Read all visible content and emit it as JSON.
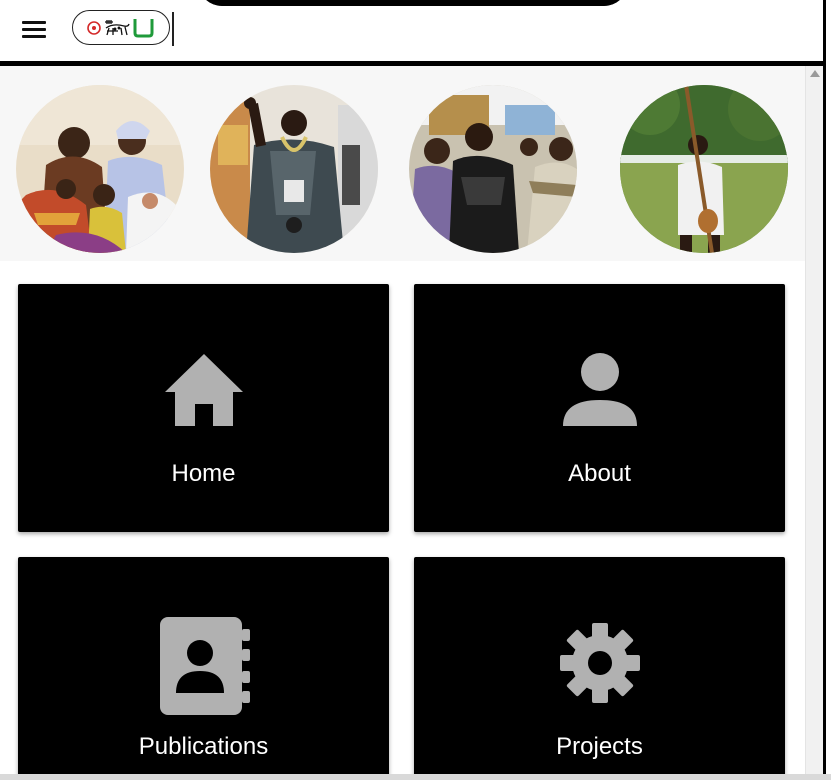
{
  "header": {
    "menu_icon": "hamburger-menu-icon",
    "logo_description_icons": [
      "target-icon",
      "leopard-icon",
      "green-u-icon"
    ]
  },
  "gallery": {
    "photos": [
      {
        "name": "family-photo"
      },
      {
        "name": "ceremonial-robe-photo"
      },
      {
        "name": "procession-photo"
      },
      {
        "name": "musician-photo"
      }
    ]
  },
  "tiles": {
    "home": {
      "label": "Home",
      "icon": "house-icon"
    },
    "about": {
      "label": "About",
      "icon": "person-icon"
    },
    "publications": {
      "label": "Publications",
      "icon": "contact-book-icon"
    },
    "projects": {
      "label": "Projects",
      "icon": "gear-icon"
    }
  },
  "colors": {
    "tile_background": "#000000",
    "icon_gray": "#b1b1b1",
    "logo_red": "#d42a2a",
    "logo_green": "#1f9a3a"
  }
}
